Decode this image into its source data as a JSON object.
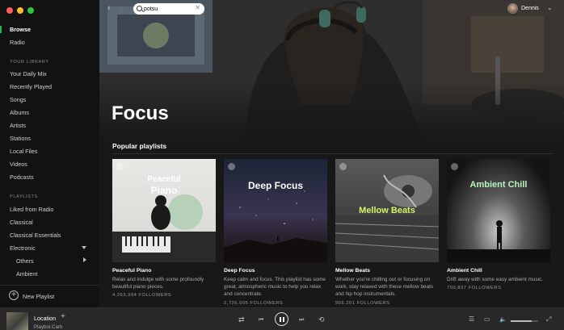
{
  "window": {
    "traffic_lights": [
      "#ff5f57",
      "#febc2e",
      "#28c840"
    ]
  },
  "sidebar": {
    "browse": "Browse",
    "radio": "Radio",
    "library_header": "YOUR LIBRARY",
    "library_items": [
      "Your Daily Mix",
      "Recently Played",
      "Songs",
      "Albums",
      "Artists",
      "Stations",
      "Local Files",
      "Videos",
      "Podcasts"
    ],
    "playlists_header": "PLAYLISTS",
    "playlists": [
      "Liked from Radio",
      "Classical",
      "Classical Essentials",
      "Electronic",
      "Others",
      "Ambient"
    ],
    "new_playlist": "New Playlist",
    "accent": "#1db954"
  },
  "topbar": {
    "back": "‹",
    "forward": "›",
    "search_value": "potsu",
    "clear": "✕",
    "user_name": "Dennis",
    "caret": "⌄"
  },
  "page": {
    "title": "Focus",
    "section_title": "Popular playlists"
  },
  "playlists": [
    {
      "name": "Peaceful Piano",
      "cover_line1": "Peaceful",
      "cover_line2": "Piano",
      "desc": "Relax and indulge with some profoundly beautiful piano pieces.",
      "followers": "4,263,994 FOLLOWERS"
    },
    {
      "name": "Deep Focus",
      "cover_line1": "Deep Focus",
      "desc": "Keep calm and focus. This playlist has some great, atmospheric music to help you relax and concentrate.",
      "followers": "2,726,005 FOLLOWERS"
    },
    {
      "name": "Mellow Beats",
      "cover_line1": "Mellow Beats",
      "desc": "Whether you're chilling out or focusing on work, stay relaxed with these mellow beats and hip hop instrumentals.",
      "followers": "966,201 FOLLOWERS"
    },
    {
      "name": "Ambient Chill",
      "cover_line1": "Ambient Chill",
      "desc": "Drift away with some easy ambient music.",
      "followers": "700,837 FOLLOWERS"
    }
  ],
  "player": {
    "track": "Location",
    "artist": "Playboi Carti",
    "add": "+",
    "shuffle": "⇄",
    "prev": "⏮",
    "next": "⏭",
    "repeat": "⟲",
    "queue": "☰",
    "devices": "▭",
    "volume": "🔈",
    "volume_level": 0.75,
    "fullscreen": "⤢"
  }
}
